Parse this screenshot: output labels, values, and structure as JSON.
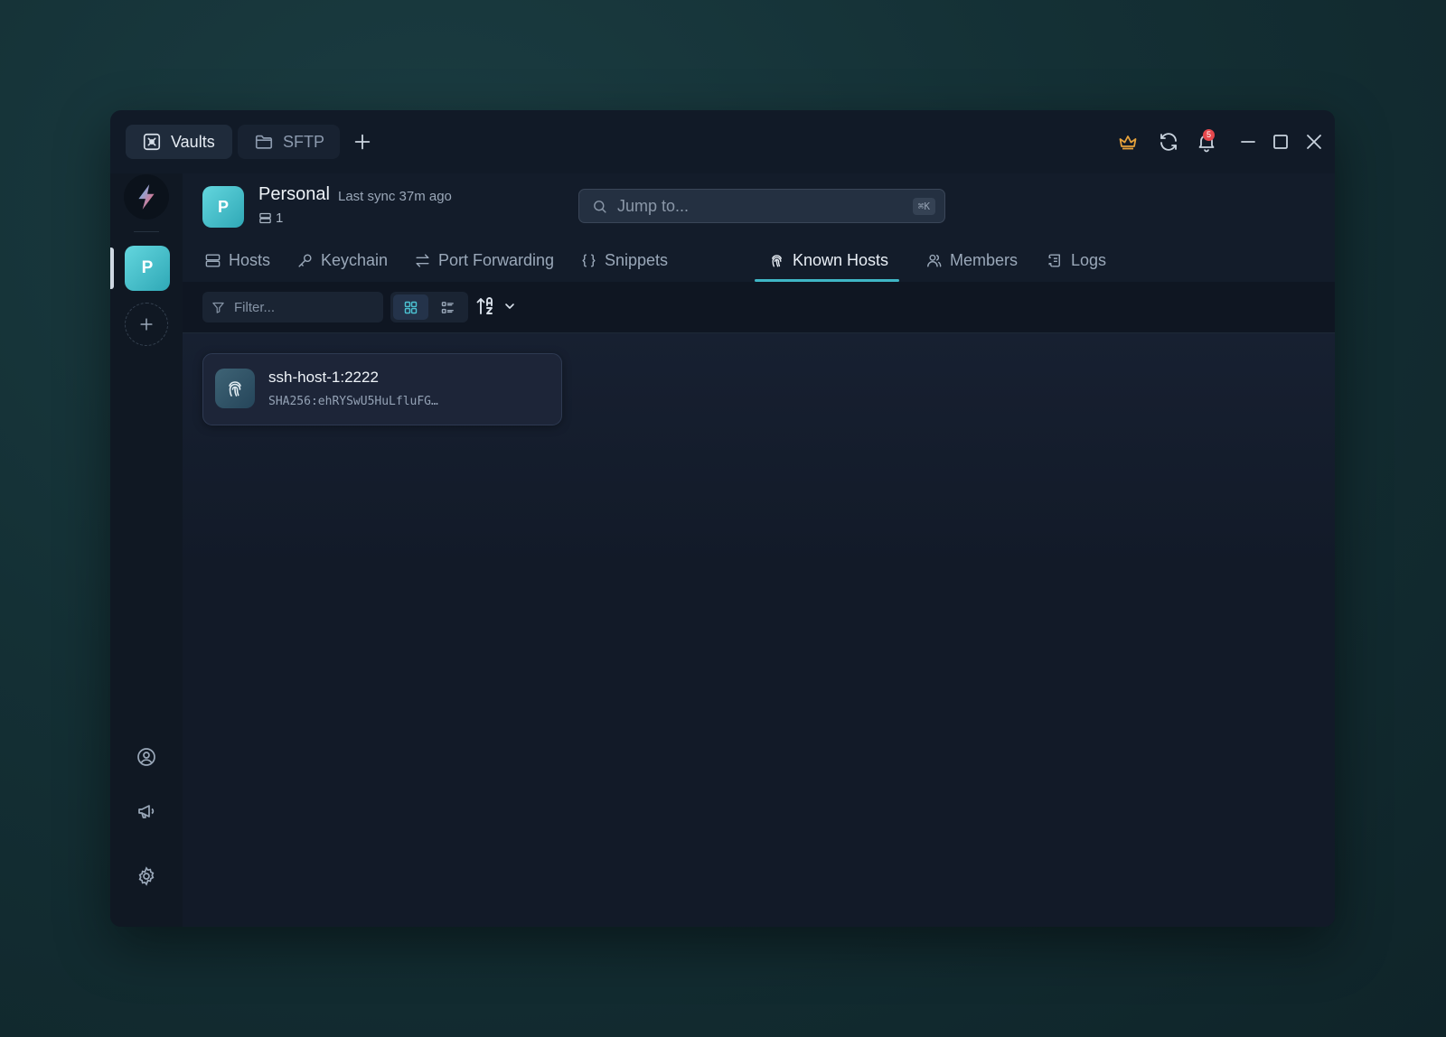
{
  "titlebar": {
    "tabs": [
      {
        "label": "Vaults",
        "icon": "vault-icon"
      },
      {
        "label": "SFTP",
        "icon": "folder-icon"
      }
    ],
    "notifications_count": "5",
    "premium_color": "#e6a23c"
  },
  "vault": {
    "initial": "P",
    "name": "Personal",
    "sync_status": "Last sync 37m ago",
    "host_count": "1"
  },
  "search": {
    "placeholder": "Jump to...",
    "shortcut": "⌘K"
  },
  "nav": {
    "items": [
      {
        "label": "Hosts",
        "icon": "server-icon"
      },
      {
        "label": "Keychain",
        "icon": "key-icon"
      },
      {
        "label": "Port Forwarding",
        "icon": "arrows-icon"
      },
      {
        "label": "Snippets",
        "icon": "braces-icon"
      },
      {
        "label": "Known Hosts",
        "icon": "fingerprint-icon",
        "active": true
      },
      {
        "label": "Members",
        "icon": "users-icon"
      },
      {
        "label": "Logs",
        "icon": "scroll-icon"
      }
    ]
  },
  "toolbar": {
    "filter_placeholder": "Filter...",
    "view_mode": "grid"
  },
  "known_hosts": [
    {
      "host": "ssh-host-1:2222",
      "fingerprint": "SHA256:ehRYSwU5HuLfluFG…"
    }
  ],
  "colors": {
    "accent": "#3fb6c6",
    "vault_avatar": "#4cc3cd",
    "notification_badge": "#e5484d"
  }
}
